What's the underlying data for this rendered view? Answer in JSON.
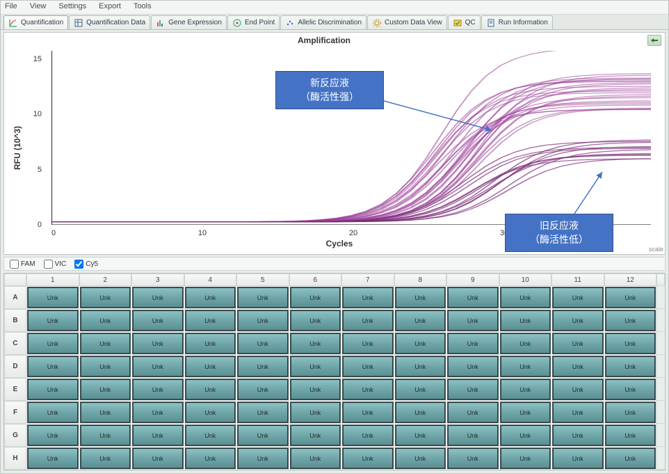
{
  "menu": [
    "File",
    "View",
    "Settings",
    "Export",
    "Tools"
  ],
  "tabs": [
    {
      "label": "Quantification",
      "icon": "chart-icon",
      "active": true
    },
    {
      "label": "Quantification Data",
      "icon": "table-icon"
    },
    {
      "label": "Gene Expression",
      "icon": "bars-icon"
    },
    {
      "label": "End Point",
      "icon": "target-icon"
    },
    {
      "label": "Allelic Discrimination",
      "icon": "scatter-icon"
    },
    {
      "label": "Custom Data View",
      "icon": "gear-icon"
    },
    {
      "label": "QC",
      "icon": "qc-icon"
    },
    {
      "label": "Run Information",
      "icon": "doc-icon"
    }
  ],
  "chart_data": {
    "type": "line",
    "title": "Amplification",
    "xlabel": "Cycles",
    "ylabel": "RFU (10^3)",
    "x_ticks": [
      "0",
      "10",
      "20",
      "30"
    ],
    "y_ticks": [
      "15",
      "10",
      "5",
      "0"
    ],
    "xlim": [
      0,
      40
    ],
    "ylim": [
      0,
      18
    ],
    "scale_note": "scale",
    "annotations": [
      {
        "name": "new",
        "line1": "新反应液",
        "line2": "（酶活性强）"
      },
      {
        "name": "old",
        "line1": "旧反应液",
        "line2": "（酶活性低）"
      }
    ],
    "series": [
      {
        "name": "high_band",
        "group": "new",
        "xmid": 27,
        "plateau": 13.5,
        "n": 22,
        "spread": 1.6
      },
      {
        "name": "top_outlier",
        "group": "new",
        "xmid": 26,
        "plateau": 18.3,
        "n": 1,
        "spread": 0
      },
      {
        "name": "mid_outlier",
        "group": "new",
        "xmid": 27,
        "plateau": 15.5,
        "n": 3,
        "spread": 0.5
      },
      {
        "name": "low_band",
        "group": "old",
        "xmid": 29,
        "plateau": 7.8,
        "n": 12,
        "spread": 1.0
      }
    ]
  },
  "fluorophores": [
    {
      "label": "FAM",
      "checked": false
    },
    {
      "label": "VIC",
      "checked": false
    },
    {
      "label": "Cy5",
      "checked": true
    }
  ],
  "plate": {
    "cols": [
      "1",
      "2",
      "3",
      "4",
      "5",
      "6",
      "7",
      "8",
      "9",
      "10",
      "11",
      "12"
    ],
    "rows": [
      "A",
      "B",
      "C",
      "D",
      "E",
      "F",
      "G",
      "H"
    ],
    "cell_label": "Unk"
  }
}
